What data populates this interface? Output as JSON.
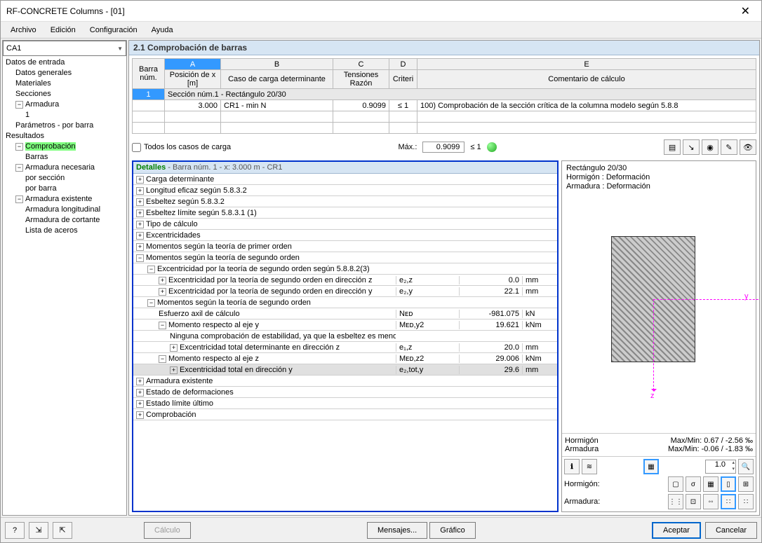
{
  "window": {
    "title": "RF-CONCRETE Columns - [01]"
  },
  "menu": {
    "archivo": "Archivo",
    "edicion": "Edición",
    "configuracion": "Configuración",
    "ayuda": "Ayuda"
  },
  "dropdown": {
    "value": "CA1"
  },
  "tree": {
    "datos_entrada": "Datos de entrada",
    "datos_generales": "Datos generales",
    "materiales": "Materiales",
    "secciones": "Secciones",
    "armadura": "Armadura",
    "armadura_1": "1",
    "parametros": "Parámetros - por barra",
    "resultados": "Resultados",
    "comprobacion": "Comprobación",
    "barras": "Barras",
    "arm_necesaria": "Armadura necesaria",
    "por_seccion": "por sección",
    "por_barra": "por barra",
    "arm_existente": "Armadura existente",
    "arm_long": "Armadura longitudinal",
    "arm_cortante": "Armadura de cortante",
    "lista_aceros": "Lista de aceros"
  },
  "section": {
    "title": "2.1 Comprobación de barras"
  },
  "table": {
    "colA": "A",
    "colB": "B",
    "colC": "C",
    "colD": "D",
    "colE": "E",
    "h_barra": "Barra núm.",
    "h_pos": "Posición de x [m]",
    "h_caso": "Caso de carga determinante",
    "h_tens": "Tensiones Razón",
    "h_crit": "Criteri",
    "h_com": "Comentario de cálculo",
    "group": "Sección núm.1 - Rectángulo 20/30",
    "row": {
      "num": "1",
      "x": "3.000",
      "caso": "CR1 - min N",
      "razon": "0.9099",
      "crit": "≤ 1",
      "comentario": "100) Comprobación de la sección crítica de la columna modelo según 5.8.8"
    }
  },
  "filter": {
    "chk_label": "Todos los casos de carga",
    "max_label": "Máx.:",
    "max_val": "0.9099",
    "max_crit": "≤ 1"
  },
  "details": {
    "title": "Detalles",
    "subtitle": " - Barra núm. 1  -  x: 3.000 m  -  CR1",
    "rows": [
      {
        "ind": 0,
        "exp": "+",
        "txt": "Carga determinante"
      },
      {
        "ind": 0,
        "exp": "+",
        "txt": "Longitud eficaz según 5.8.3.2"
      },
      {
        "ind": 0,
        "exp": "+",
        "txt": "Esbeltez según 5.8.3.2"
      },
      {
        "ind": 0,
        "exp": "+",
        "txt": "Esbeltez límite según 5.8.3.1 (1)"
      },
      {
        "ind": 0,
        "exp": "+",
        "txt": "Tipo de cálculo"
      },
      {
        "ind": 0,
        "exp": "+",
        "txt": "Excentricidades"
      },
      {
        "ind": 0,
        "exp": "+",
        "txt": "Momentos según la teoría de primer orden"
      },
      {
        "ind": 0,
        "exp": "−",
        "txt": "Momentos según la teoría de segundo orden"
      },
      {
        "ind": 1,
        "exp": "−",
        "txt": "Excentricidad por la teoría de segundo orden según 5.8.8.2(3)"
      },
      {
        "ind": 2,
        "exp": "+",
        "txt": "Excentricidad por la teoría de segundo orden en dirección z",
        "sym": "e₂,z",
        "val": "0.0",
        "unit": "mm"
      },
      {
        "ind": 2,
        "exp": "+",
        "txt": "Excentricidad por la teoría de segundo orden en dirección y",
        "sym": "e₂,y",
        "val": "22.1",
        "unit": "mm"
      },
      {
        "ind": 1,
        "exp": "−",
        "txt": "Momentos según la teoría de segundo orden"
      },
      {
        "ind": 2,
        "exp": "",
        "txt": "Esfuerzo axil de cálculo",
        "sym": "Nᴇᴅ",
        "val": "-981.075",
        "unit": "kN"
      },
      {
        "ind": 2,
        "exp": "−",
        "txt": "Momento respecto al eje y",
        "sym": "Mᴇᴅ,y2",
        "val": "19.621",
        "unit": "kNm"
      },
      {
        "ind": 3,
        "exp": "",
        "txt": "Ninguna comprobación de estabilidad, ya que la esbeltez es menor que la esbeltez máxima"
      },
      {
        "ind": 3,
        "exp": "+",
        "txt": "Excentricidad total determinante en dirección z",
        "sym": "e₁,z",
        "val": "20.0",
        "unit": "mm"
      },
      {
        "ind": 2,
        "exp": "−",
        "txt": "Momento respecto al eje z",
        "sym": "Mᴇᴅ,z2",
        "val": "29.006",
        "unit": "kNm"
      },
      {
        "ind": 3,
        "exp": "+",
        "txt": "Excentricidad total en dirección y",
        "sym": "e₂,tot,y",
        "val": "29.6",
        "unit": "mm",
        "sel": true
      },
      {
        "ind": 0,
        "exp": "+",
        "txt": "Armadura existente"
      },
      {
        "ind": 0,
        "exp": "+",
        "txt": "Estado de deformaciones"
      },
      {
        "ind": 0,
        "exp": "+",
        "txt": "Estado límite último"
      },
      {
        "ind": 0,
        "exp": "+",
        "txt": "Comprobación"
      }
    ]
  },
  "viz": {
    "h1": "Rectángulo 20/30",
    "h2": "Hormigón : Deformación",
    "h3": "Armadura : Deformación",
    "axis_y": "y",
    "axis_z": "z",
    "foot_hormigon_lbl": "Hormigón",
    "foot_hormigon_val": "Max/Min:  0.67 / -2.56 ‰",
    "foot_armadura_lbl": "Armadura",
    "foot_armadura_val": "Max/Min:  -0.06 / -1.83 ‰",
    "spin": "1.0",
    "row_h": "Hormigón:",
    "row_a": "Armadura:"
  },
  "bottom": {
    "calculo": "Cálculo",
    "mensajes": "Mensajes...",
    "grafico": "Gráfico",
    "aceptar": "Aceptar",
    "cancelar": "Cancelar"
  }
}
